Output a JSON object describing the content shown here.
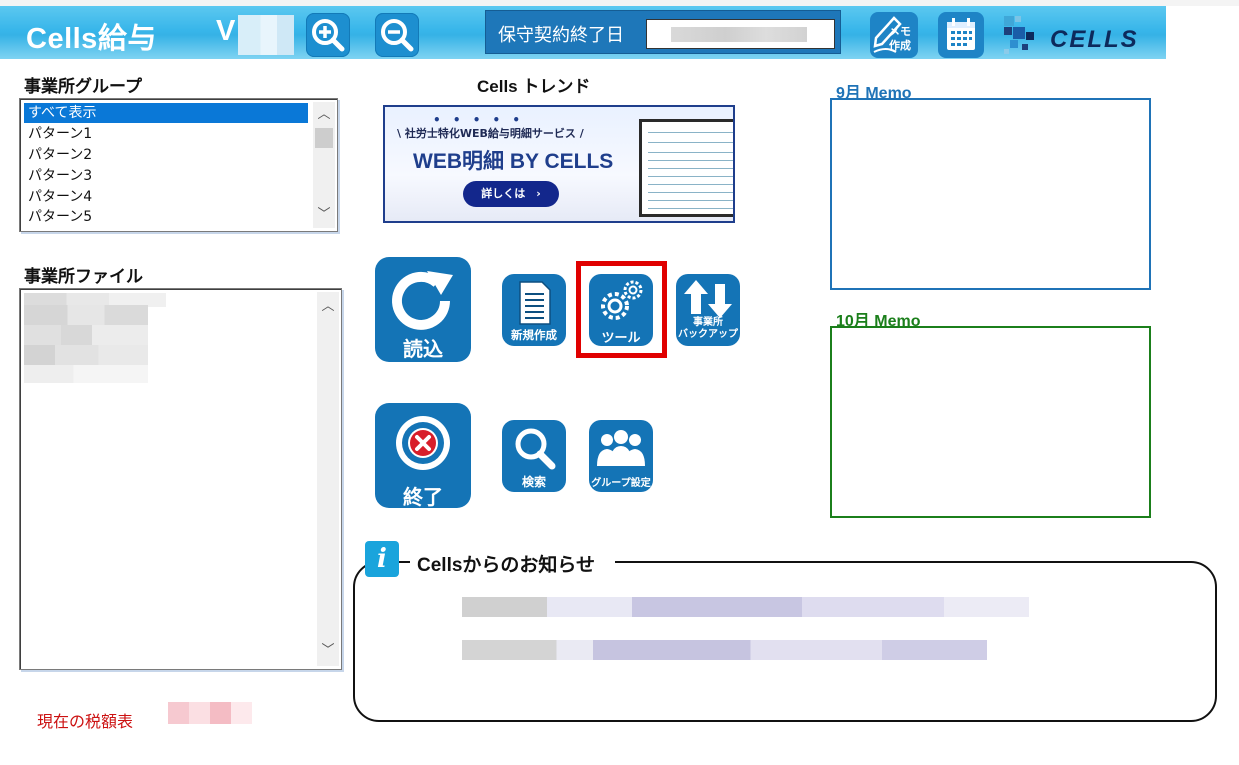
{
  "header": {
    "app_title": "Cells給与",
    "version_prefix": "V",
    "contract_label": "保守契約終了日",
    "memo_button": [
      "メモ",
      "作成"
    ],
    "logo_text": "CELLS"
  },
  "left": {
    "group_label": "事業所グループ",
    "group_items": [
      "すべて表示",
      "パターン1",
      "パターン2",
      "パターン3",
      "パターン4",
      "パターン5"
    ],
    "group_selected_index": 0,
    "file_label": "事業所ファイル",
    "tax_label": "現在の税額表"
  },
  "trend": {
    "title": "Cells トレンド",
    "banner_dots": "• • • • •",
    "banner_sub": "\\ 社労士特化WEB給与明細サービス /",
    "banner_main": "WEB明細 BY CELLS",
    "banner_button": "詳しくは　›"
  },
  "actions": {
    "read": "読込",
    "new": "新規作成",
    "tool": "ツール",
    "backup": [
      "事業所",
      "バックアップ"
    ],
    "exit": "終了",
    "search": "検索",
    "group_settings": "グループ設定"
  },
  "memo": {
    "sep_label": "9月 Memo",
    "oct_label": "10月 Memo",
    "sep_color": "#1f73b7",
    "oct_color": "#1b7f1b"
  },
  "news": {
    "title": "Cellsからのお知らせ",
    "info_icon": "i"
  },
  "colors": {
    "header": "#38b6ea",
    "button": "#1474b6",
    "highlight": "#e00000"
  }
}
